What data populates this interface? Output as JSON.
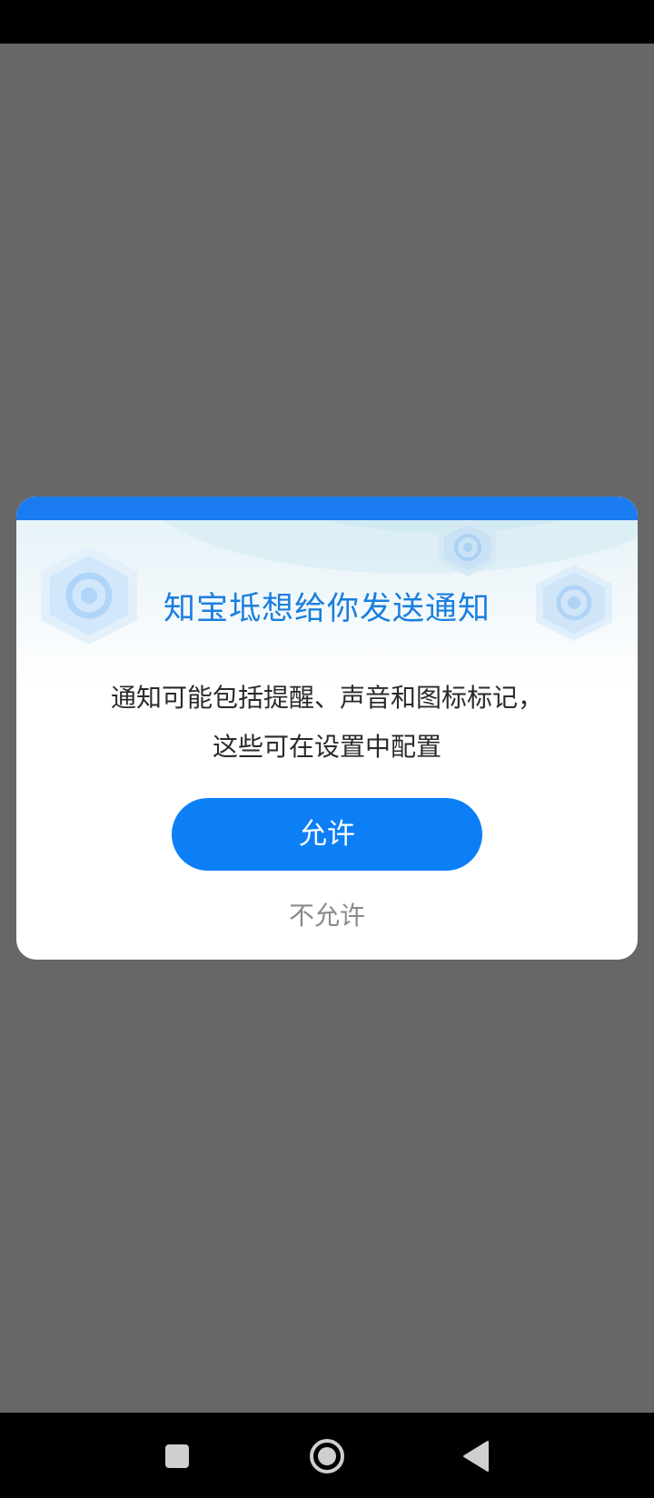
{
  "dialog": {
    "title": "知宝坻想给你发送通知",
    "message_line1": "通知可能包括提醒、声音和图标标记，",
    "message_line2": "这些可在设置中配置",
    "allow_label": "允许",
    "deny_label": "不允许"
  },
  "nav_bar": {
    "recent_icon": "square-icon",
    "home_icon": "circle-home-icon",
    "back_icon": "triangle-back-icon"
  },
  "colors": {
    "accent": "#0c7ff6",
    "title": "#1a7fe0",
    "overlay": "#676767",
    "deny_text": "#8a8a8a"
  }
}
